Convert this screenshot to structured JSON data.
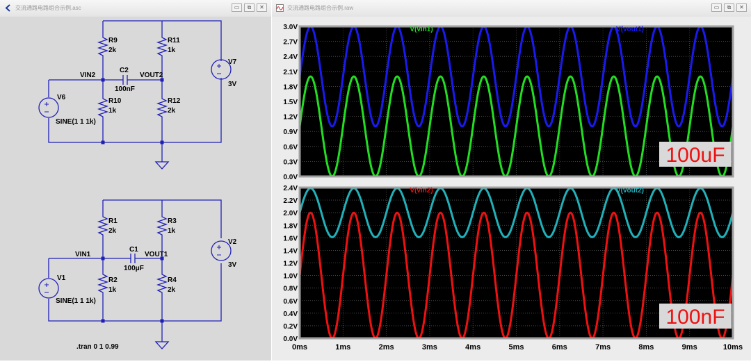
{
  "schematic_window": {
    "title": "交流通路电路组合示例.asc",
    "buttons": [
      "▭",
      "⧉",
      "✕"
    ],
    "circuit_top": {
      "R9": {
        "name": "R9",
        "value": "2k"
      },
      "R10": {
        "name": "R10",
        "value": "1k"
      },
      "R11": {
        "name": "R11",
        "value": "1k"
      },
      "R12": {
        "name": "R12",
        "value": "2k"
      },
      "C2": {
        "name": "C2",
        "value": "100nF"
      },
      "V6": {
        "name": "V6",
        "value": "SINE(1 1 1k)"
      },
      "V7": {
        "name": "V7",
        "value": "3V"
      },
      "net_in": "VIN2",
      "net_out": "VOUT2"
    },
    "circuit_bottom": {
      "R1": {
        "name": "R1",
        "value": "2k"
      },
      "R2": {
        "name": "R2",
        "value": "1k"
      },
      "R3": {
        "name": "R3",
        "value": "1k"
      },
      "R4": {
        "name": "R4",
        "value": "2k"
      },
      "C1": {
        "name": "C1",
        "value": "100μF"
      },
      "V1": {
        "name": "V1",
        "value": "SINE(1 1 1k)"
      },
      "V2": {
        "name": "V2",
        "value": "3V"
      },
      "net_in": "VIN1",
      "net_out": "VOUT1"
    },
    "directive": ".tran 0 1 0.99",
    "wire_color": "#0000cc"
  },
  "plot_window": {
    "title": "交流通路电路组合示例.raw",
    "buttons": [
      "▭",
      "⧉",
      "✕"
    ]
  },
  "chart_data": [
    {
      "type": "line",
      "legend": [
        "V(vin1)",
        "V(vout1)"
      ],
      "annotation": "100uF",
      "ylim": [
        0,
        3.0
      ],
      "y_ticks": [
        "0.0V",
        "0.3V",
        "0.6V",
        "0.9V",
        "1.2V",
        "1.5V",
        "1.8V",
        "2.1V",
        "2.4V",
        "2.7V",
        "3.0V"
      ],
      "xlim_ms": [
        0,
        10
      ],
      "series": [
        {
          "name": "V(vin1)",
          "color": "#22dd22",
          "offset": 1.0,
          "amplitude": 1.0,
          "freq_khz": 1
        },
        {
          "name": "V(vout1)",
          "color": "#1a1aee",
          "offset": 2.0,
          "amplitude": 1.0,
          "freq_khz": 1
        }
      ]
    },
    {
      "type": "line",
      "legend": [
        "V(vin2)",
        "V(vout2)"
      ],
      "annotation": "100nF",
      "ylim": [
        0,
        2.4
      ],
      "y_ticks": [
        "0.0V",
        "0.2V",
        "0.4V",
        "0.6V",
        "0.8V",
        "1.0V",
        "1.2V",
        "1.4V",
        "1.6V",
        "1.8V",
        "2.0V",
        "2.2V",
        "2.4V"
      ],
      "xlim_ms": [
        0,
        10
      ],
      "x_ticks": [
        "0ms",
        "1ms",
        "2ms",
        "3ms",
        "4ms",
        "5ms",
        "6ms",
        "7ms",
        "8ms",
        "9ms",
        "10ms"
      ],
      "series": [
        {
          "name": "V(vin2)",
          "color": "#ee1111",
          "offset": 1.0,
          "amplitude": 1.0,
          "freq_khz": 1
        },
        {
          "name": "V(vout2)",
          "color": "#20b0b8",
          "offset": 2.0,
          "amplitude": 0.39,
          "freq_khz": 1
        }
      ]
    }
  ]
}
